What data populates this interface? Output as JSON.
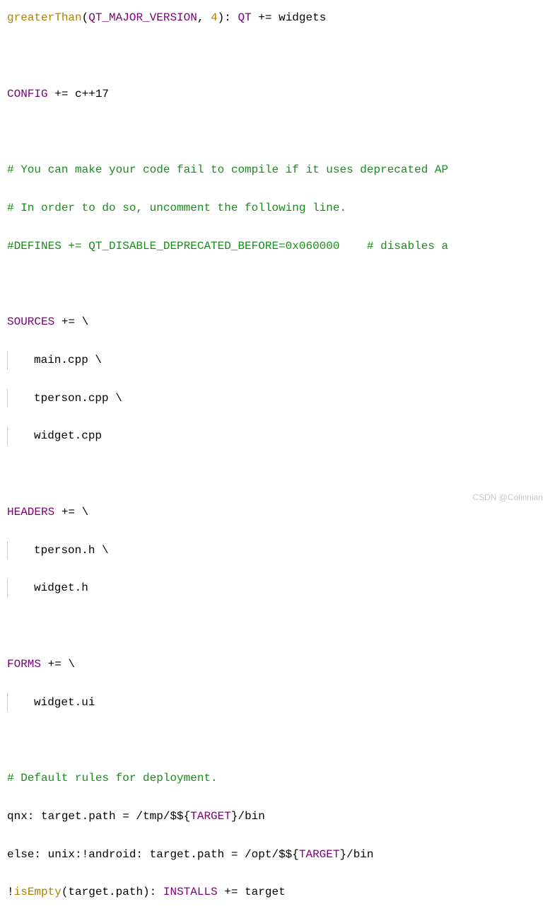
{
  "code": {
    "l1_func": "greaterThan",
    "l1_open": "(",
    "l1_var": "QT_MAJOR_VERSION",
    "l1_comma": ", ",
    "l1_num": "4",
    "l1_close": "): ",
    "l1_qt": "QT",
    "l1_tail": " += widgets",
    "l3_var": "CONFIG",
    "l3_tail": " += c++17",
    "l5_comment": "# You can make your code fail to compile if it uses deprecated AP",
    "l6_comment": "# In order to do so, uncomment the following line.",
    "l7_comment": "#DEFINES += QT_DISABLE_DEPRECATED_BEFORE=0x060000    # disables a",
    "l9_var": "SOURCES",
    "l9_tail": " += \\",
    "l10": "main.cpp \\",
    "l11": "tperson.cpp \\",
    "l12": "widget.cpp",
    "l14_var": "HEADERS",
    "l14_tail": " += \\",
    "l15": "tperson.h \\",
    "l16": "widget.h",
    "l18_var": "FORMS",
    "l18_tail": " += \\",
    "l19": "widget.ui",
    "l21_comment": "# Default rules for deployment.",
    "l22_a": "qnx: target.path = /tmp/$${",
    "l22_var": "TARGET",
    "l22_b": "}/bin",
    "l23_a": "else: unix:!android: target.path = /opt/$${",
    "l23_var": "TARGET",
    "l23_b": "}/bin",
    "l24_a": "!",
    "l24_func": "isEmpty",
    "l24_b": "(target.path): ",
    "l24_var": "INSTALLS",
    "l24_c": " += target"
  },
  "watermark": "CSDN @Colinnian"
}
